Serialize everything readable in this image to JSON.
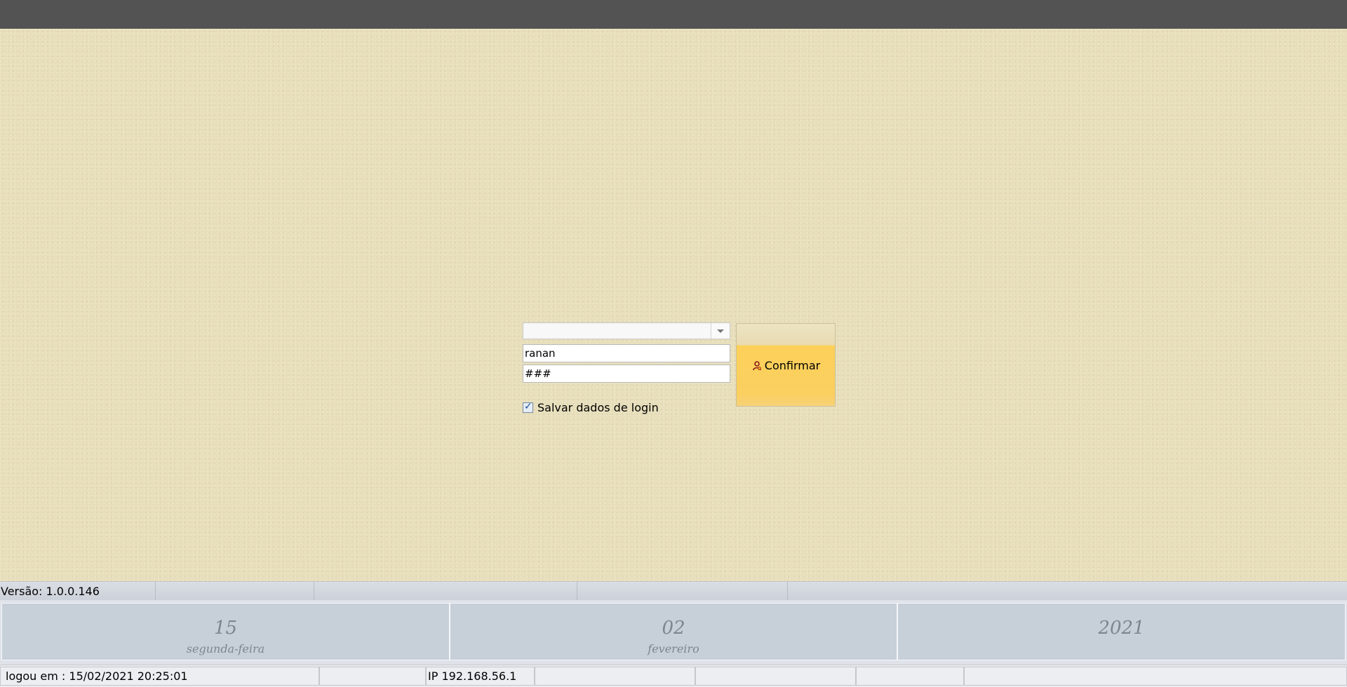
{
  "login": {
    "profile_value": "",
    "username": "ranan",
    "password": "###",
    "save_label": "Salvar dados de login",
    "save_checked": true,
    "confirm_label": "Confirmar"
  },
  "status_top": {
    "version": "Versão: 1.0.0.146",
    "cells": [
      "",
      "",
      "",
      ""
    ]
  },
  "date": {
    "day": "15",
    "weekday": "segunda-feira",
    "month_number": "02",
    "month_name": "fevereiro",
    "year": "2021"
  },
  "status_bottom": {
    "login_time": "logou em : 15/02/2021 20:25:01",
    "cell2": "",
    "ip": "IP 192.168.56.1",
    "cell4": "",
    "cell5": "",
    "cell6": "",
    "cell7": ""
  },
  "colors": {
    "background": "#e6ddb7",
    "confirm": "#fcd059",
    "date_panel": "#c7cfd9"
  }
}
